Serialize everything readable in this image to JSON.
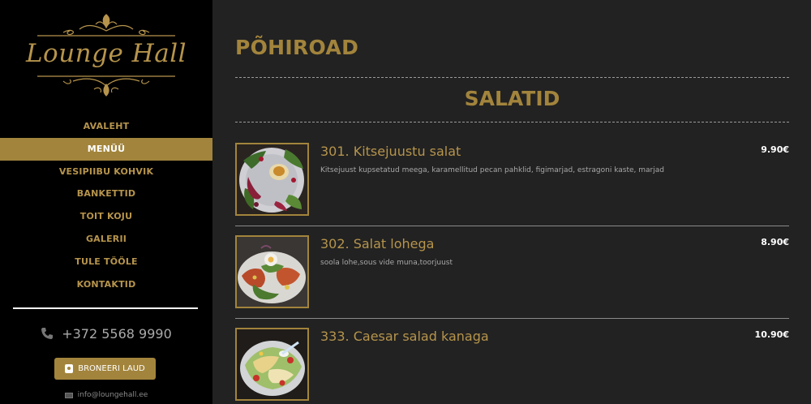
{
  "brand": {
    "logo_text": "Lounge Hall"
  },
  "nav": {
    "items": [
      {
        "label": "AVALEHT",
        "active": false
      },
      {
        "label": "MENÜÜ",
        "active": true
      },
      {
        "label": "VESIPIIBU KOHVIK",
        "active": false
      },
      {
        "label": "BANKETTID",
        "active": false
      },
      {
        "label": "TOIT KOJU",
        "active": false
      },
      {
        "label": "GALERII",
        "active": false
      },
      {
        "label": "TULE TÖÖLE",
        "active": false
      },
      {
        "label": "KONTAKTID",
        "active": false
      }
    ]
  },
  "contact": {
    "phone": "+372 5568 9990",
    "phone_icon": "phone-icon",
    "book_label": "BRONEERI LAUD",
    "book_icon": "calendar-icon",
    "email": "info@loungehall.ee",
    "email_icon": "mail-icon"
  },
  "main": {
    "title": "PÕHIROAD",
    "section": "SALATID",
    "items": [
      {
        "name": "301. Kitsejuustu salat",
        "description": "Kitsejuust kupsetatud meega, karamellitud pecan pahklid, figimarjad, estragoni kaste, marjad",
        "price": "9.90€"
      },
      {
        "name": "302. Salat lohega",
        "description": "soola lohe,sous vide muna,toorjuust",
        "price": "8.90€"
      },
      {
        "name": "333. Caesar salad kanaga",
        "description": "",
        "price": "10.90€"
      }
    ]
  },
  "colors": {
    "accent": "#a2843c",
    "gold_text": "#b6944c",
    "background": "#222222",
    "sidebar": "#000000"
  }
}
